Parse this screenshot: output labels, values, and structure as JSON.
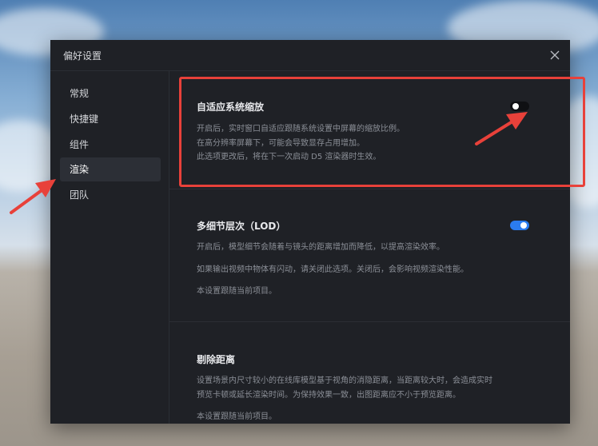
{
  "dialog": {
    "title": "偏好设置"
  },
  "sidebar": {
    "items": [
      {
        "label": "常规"
      },
      {
        "label": "快捷键"
      },
      {
        "label": "组件"
      },
      {
        "label": "渲染",
        "active": true
      },
      {
        "label": "团队"
      }
    ]
  },
  "sections": {
    "adaptive_scaling": {
      "title": "自适应系统缩放",
      "desc": [
        "开启后，实时窗口自适应跟随系统设置中屏幕的缩放比例。",
        "在高分辨率屏幕下，可能会导致显存占用增加。",
        "此选项更改后，将在下一次启动 D5 渲染器时生效。"
      ],
      "enabled": false
    },
    "lod": {
      "title": "多细节层次（LOD）",
      "desc": [
        "开启后，模型细节会随着与镜头的距离增加而降低，以提高渲染效率。",
        "如果输出视频中物体有闪动，请关闭此选项。关闭后，会影响视频渲染性能。",
        "本设置跟随当前项目。"
      ],
      "enabled": true
    },
    "culling": {
      "title": "剔除距离",
      "desc": [
        "设置场景内尺寸较小的在线库模型基于视角的消隐距离，当距离较大时，会造成实时",
        "预览卡顿或延长渲染时间。为保持效果一致，出图距离应不小于预览距离。",
        "本设置跟随当前项目。"
      ]
    }
  },
  "colors": {
    "accent": "#2b7cf0",
    "annotation": "#e8413a"
  }
}
